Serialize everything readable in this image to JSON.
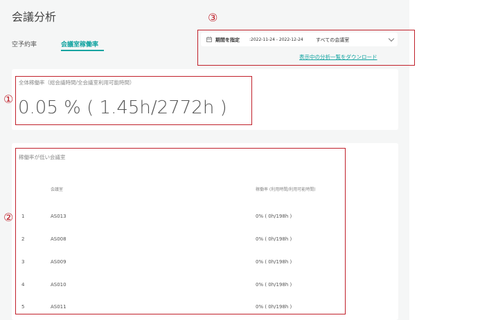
{
  "page": {
    "title": "会議分析"
  },
  "tabs": [
    {
      "label": "空予約率"
    },
    {
      "label": "会議室稼働率"
    }
  ],
  "filter": {
    "button_label": "期間を指定",
    "date_range": ":2022-11-24 - 2022-12-24",
    "room_select": "すべての会議室",
    "download_link": "表示中の分析一覧をダウンロード"
  },
  "overall": {
    "label": "全体稼働率（総会議時間/全会議室利用可能時間）",
    "value": "0.05 % ( 1.45h/2772h )"
  },
  "low_rooms": {
    "title": "稼働率が低い会議室",
    "headers": {
      "room": "会議室",
      "rate": "稼働率 (利用時間/利用可能時間)"
    },
    "rows": [
      {
        "rank": "1",
        "room": "AS013",
        "rate": "0% ( 0h/198h )"
      },
      {
        "rank": "2",
        "room": "AS008",
        "rate": "0% ( 0h/198h )"
      },
      {
        "rank": "3",
        "room": "AS009",
        "rate": "0% ( 0h/198h )"
      },
      {
        "rank": "4",
        "room": "AS010",
        "rate": "0% ( 0h/198h )"
      },
      {
        "rank": "5",
        "room": "AS011",
        "rate": "0% ( 0h/198h )"
      }
    ]
  },
  "markers": {
    "one": "①",
    "two": "②",
    "three": "③"
  },
  "colors": {
    "accent": "#11a3a0",
    "annotation": "#c0202a"
  }
}
